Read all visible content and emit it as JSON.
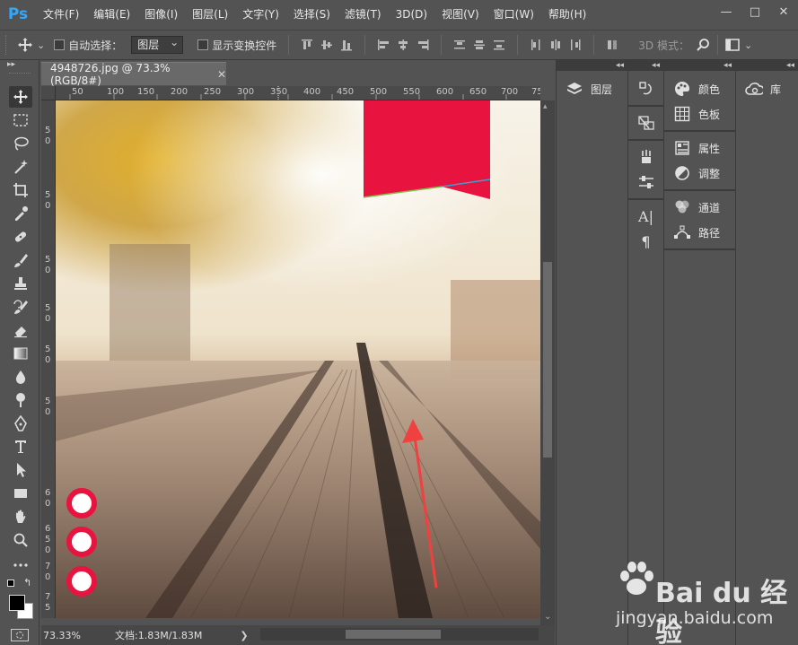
{
  "app": {
    "logo": "Ps",
    "name": "Adobe Photoshop"
  },
  "menu": [
    "文件(F)",
    "编辑(E)",
    "图像(I)",
    "图层(L)",
    "文字(Y)",
    "选择(S)",
    "滤镜(T)",
    "3D(D)",
    "视图(V)",
    "窗口(W)",
    "帮助(H)"
  ],
  "window_controls": {
    "minimize": "—",
    "maximize": "□",
    "close": "✕"
  },
  "options": {
    "auto_select_label": "自动选择：",
    "auto_select_checked": false,
    "layer_select_value": "图层",
    "show_transform_label": "显示变换控件",
    "show_transform_checked": false,
    "mode_3d_label": "3D 模式："
  },
  "document": {
    "tab_title": "4948726.jpg @ 73.3%(RGB/8#)",
    "close_symbol": "✕",
    "ruler_h": [
      "50",
      "100",
      "150",
      "200",
      "250",
      "300",
      "350",
      "400",
      "450",
      "500",
      "550",
      "600",
      "650",
      "700",
      "75"
    ],
    "ruler_v": [
      "5",
      "0",
      "5",
      "0",
      "5",
      "0",
      "5",
      "0",
      "5",
      "0",
      "5",
      "0",
      "6",
      "0",
      "6",
      "5",
      "0",
      "7",
      "0",
      "7",
      "5"
    ]
  },
  "status": {
    "zoom": "73.33%",
    "doc_info": "文档:1.83M/1.83M",
    "arrow": "❯"
  },
  "panels": {
    "layers": {
      "label": "图层",
      "icon": "layers-icon"
    },
    "group1": [
      {
        "label": "颜色",
        "icon": "palette-icon"
      },
      {
        "label": "色板",
        "icon": "grid-icon"
      }
    ],
    "group2": [
      {
        "label": "属性",
        "icon": "properties-icon"
      },
      {
        "label": "调整",
        "icon": "adjust-icon"
      }
    ],
    "group3": [
      {
        "label": "通道",
        "icon": "channels-icon"
      },
      {
        "label": "路径",
        "icon": "paths-icon"
      }
    ],
    "library": {
      "label": "库",
      "icon": "cloud-icon"
    },
    "collapse": "◂◂"
  },
  "watermark": {
    "brand": "Bai du 经验",
    "url": "jingyan.baidu.com"
  },
  "colors": {
    "accent_red": "#e8133e",
    "ps_blue": "#31a8ff",
    "ui_bg": "#535353",
    "arrow_red": "#f04040"
  }
}
